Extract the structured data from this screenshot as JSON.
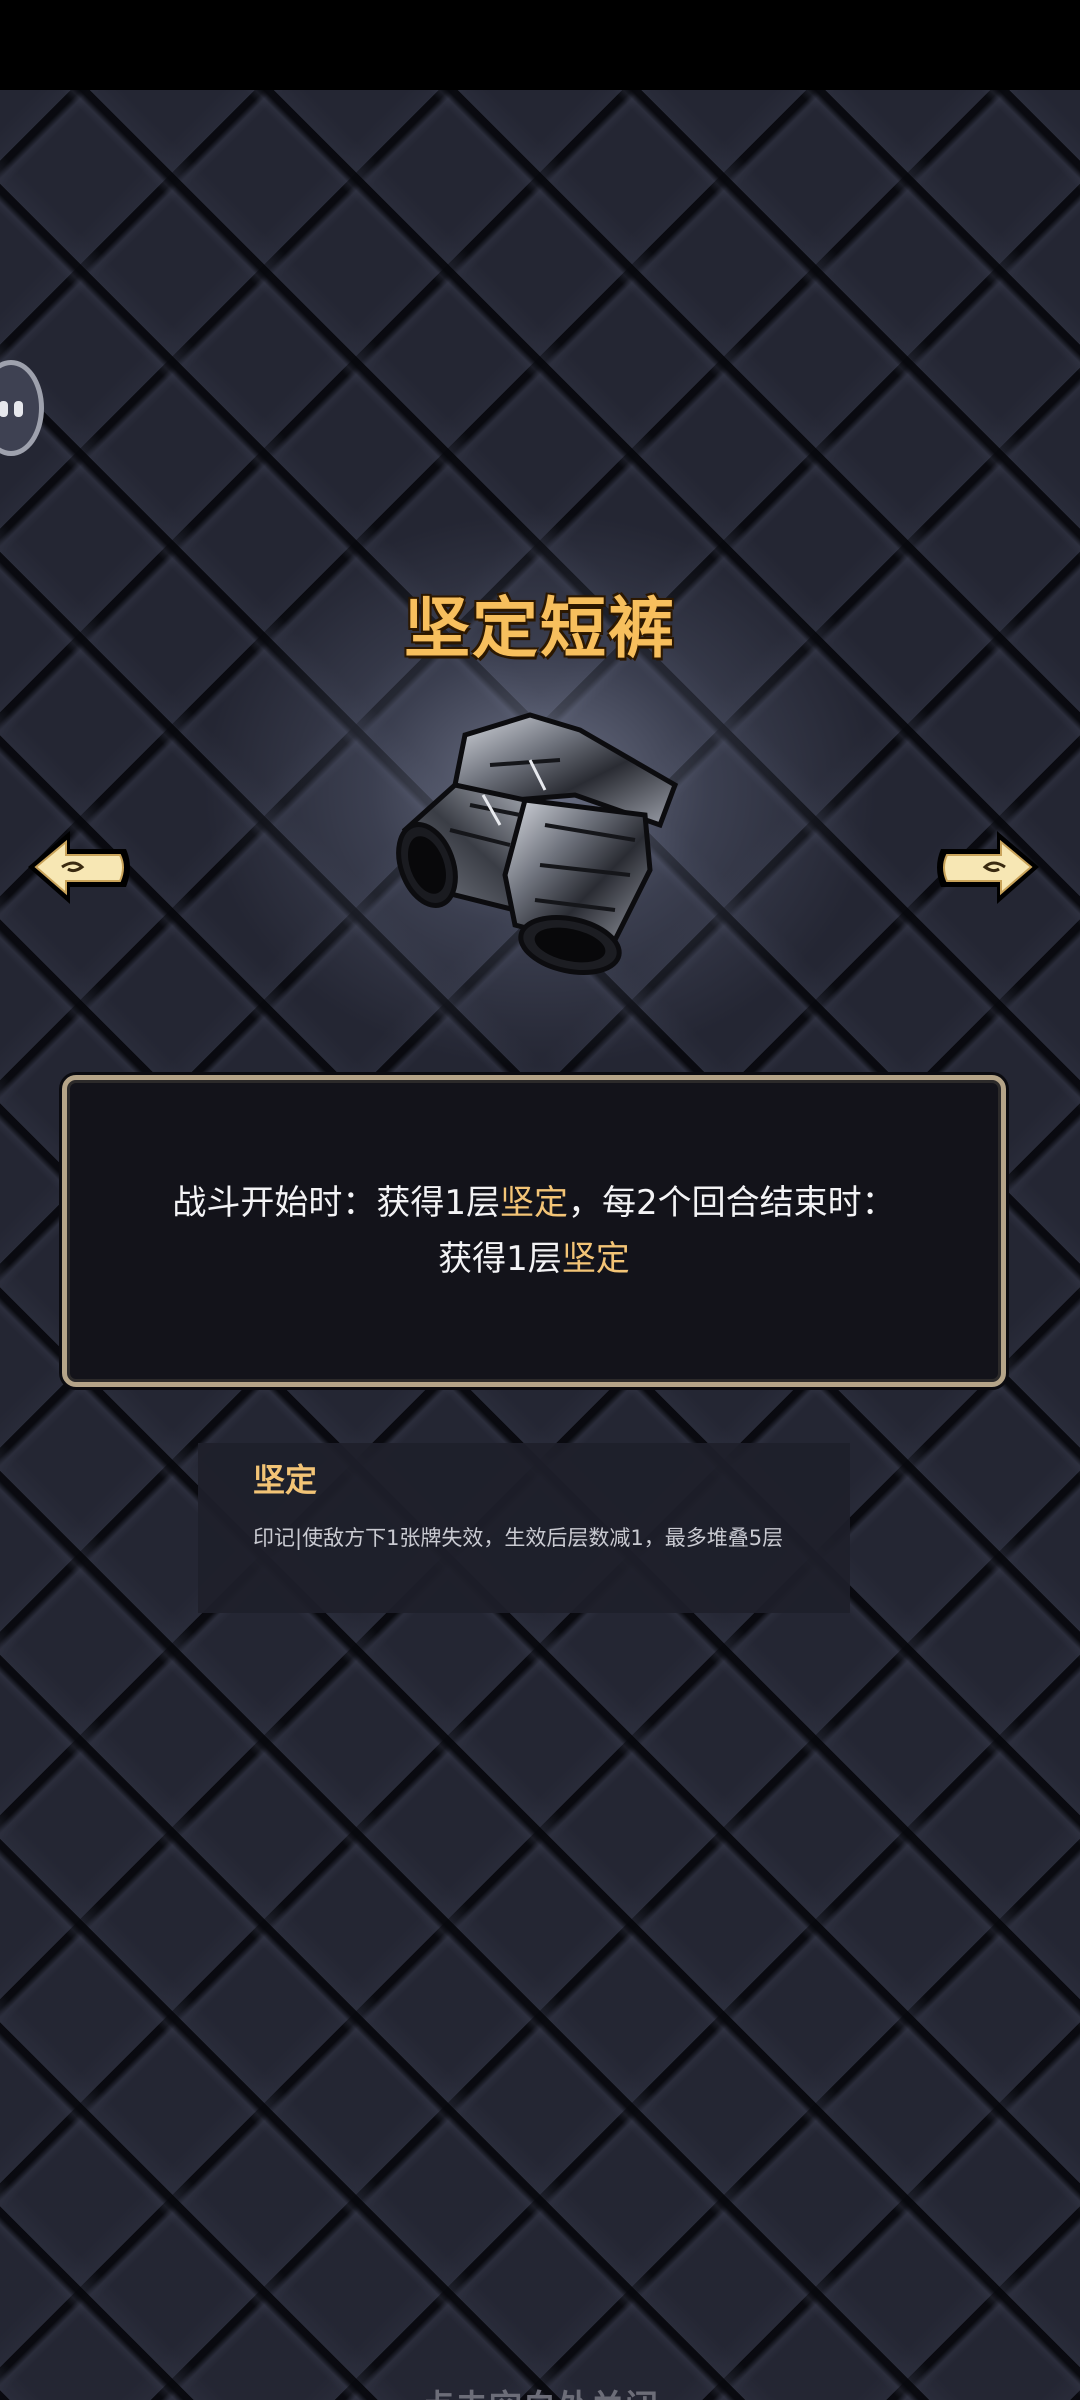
{
  "item": {
    "name": "坚定短裤"
  },
  "description": {
    "line1_prefix": "战斗开始时：获得1层",
    "line1_keyword": "坚定",
    "line1_suffix": "，每2个回合结束时：",
    "line2_prefix": "获得1层",
    "line2_keyword": "坚定"
  },
  "keyword_card": {
    "title": "坚定",
    "text": "印记|使敌方下1张牌失效，生效后层数减1，最多堆叠5层"
  },
  "footer": {
    "close_hint": "点击空白处关闭"
  },
  "icons": {
    "prev": "arrow-left-icon",
    "next": "arrow-right-icon",
    "assistant": "floating-assistant-icon",
    "item": "armored-shorts-icon"
  },
  "colors": {
    "title": "#f7bf5d",
    "keyword": "#f3c476",
    "panel_border": "#b5a488"
  }
}
